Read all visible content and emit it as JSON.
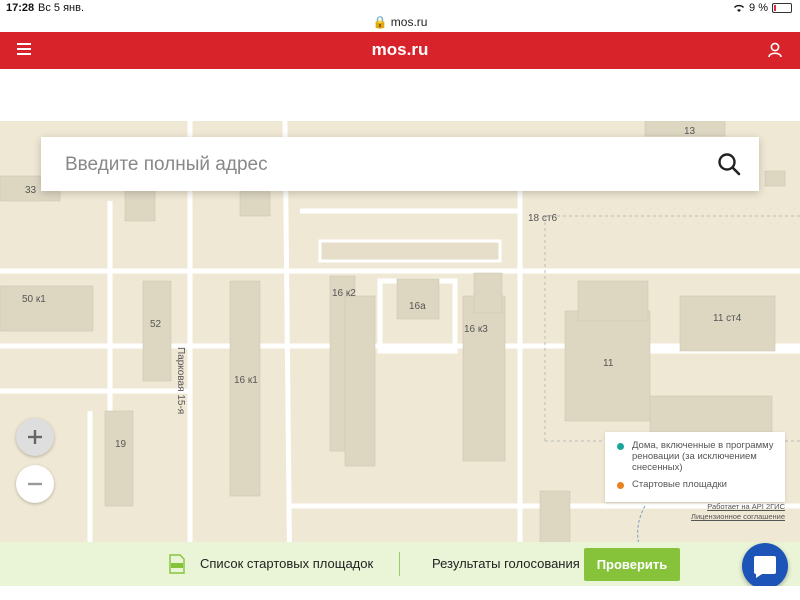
{
  "status_bar": {
    "time": "17:28",
    "date": "Вс 5 янв.",
    "url": "mos.ru",
    "battery": "9 %"
  },
  "header": {
    "title": "mos.ru"
  },
  "search": {
    "placeholder": "Введите полный адрес"
  },
  "map": {
    "labels": [
      "13",
      "33",
      "18 ст6",
      "50 к1",
      "52",
      "16 к2",
      "16а",
      "16 к3",
      "11 ст4",
      "11",
      "16 к1",
      "19"
    ],
    "street": "Парковая 15-я"
  },
  "legend": {
    "items": [
      {
        "label": "Дома, включенные в программу реновации (за исключением снесенных)",
        "color": "#1aa59b"
      },
      {
        "label": "Стартовые площадки",
        "color": "#e8821e"
      }
    ]
  },
  "attribution": {
    "api": "Работает на API 2ГИС",
    "license": "Лицензионное соглашение"
  },
  "bottom_bar": {
    "list_label": "Список стартовых площадок",
    "results_label": "Результаты голосования",
    "check_button": "Проверить"
  },
  "colors": {
    "brand_red": "#d8232a",
    "accent_green": "#86c33b",
    "chat_blue": "#1d54b8"
  }
}
